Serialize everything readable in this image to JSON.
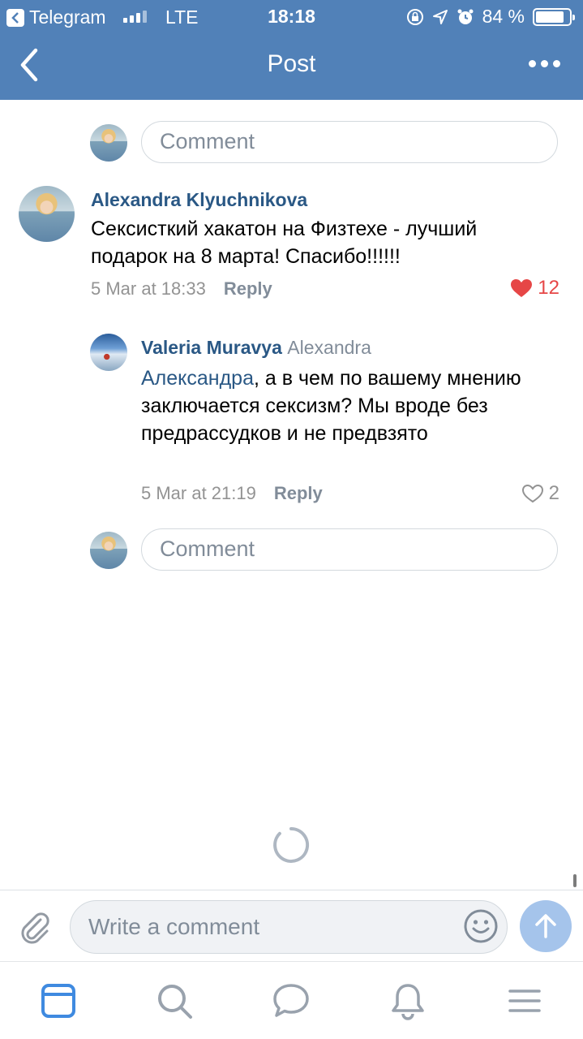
{
  "status_bar": {
    "back_app": "Telegram",
    "network": "LTE",
    "time": "18:18",
    "battery": "84 %",
    "battery_level": 0.84
  },
  "nav": {
    "title": "Post"
  },
  "top_comment_input": {
    "placeholder": "Comment"
  },
  "comments": [
    {
      "author": "Alexandra Klyuchnikova",
      "text": "Сексисткий хакатон на Физтехе - лучший подарок на 8 марта! Спасибо!!!!!!",
      "date": "5 Mar at 18:33",
      "reply_label": "Reply",
      "likes": "12",
      "liked": true
    },
    {
      "author": "Valeria Muravya",
      "reply_to": "Alexandra",
      "mention": "Александра",
      "text": ", а в чем по вашему мнению заключается сексизм? Мы вроде без предрассудков и не предвзято",
      "date": "5 Mar at 21:19",
      "reply_label": "Reply",
      "likes": "2",
      "liked": false
    }
  ],
  "reply_comment_input": {
    "placeholder": "Comment"
  },
  "composer": {
    "placeholder": "Write a comment"
  },
  "colors": {
    "header": "#5181b8",
    "link": "#2a5885",
    "like_active": "#e64646",
    "send_button": "#a5c4eb"
  },
  "tabs": [
    "news-icon",
    "search-icon",
    "messages-icon",
    "notifications-icon",
    "menu-icon"
  ]
}
